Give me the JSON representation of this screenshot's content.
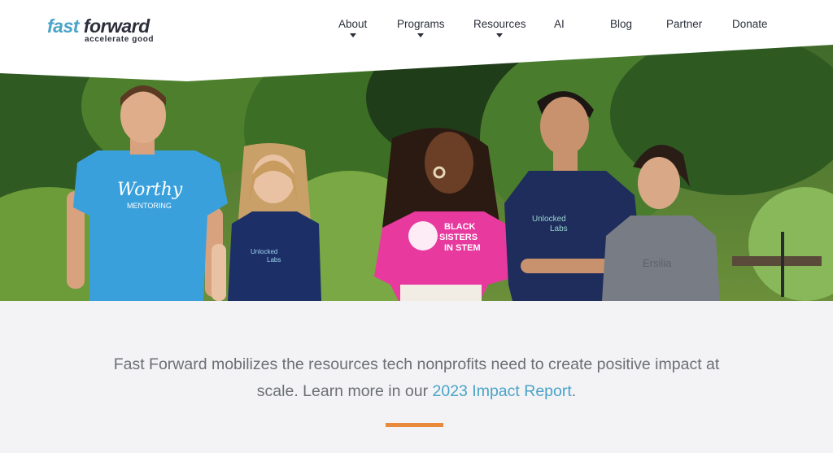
{
  "brand": {
    "name_part1": "fast",
    "name_part2": "forward",
    "tagline": "accelerate good",
    "colors": {
      "blue": "#4aa3c8",
      "dark": "#2b2f3a",
      "orange": "#e88a3a"
    }
  },
  "nav": {
    "items": [
      {
        "label": "About",
        "has_dropdown": true
      },
      {
        "label": "Programs",
        "has_dropdown": true
      },
      {
        "label": "Resources",
        "has_dropdown": true
      },
      {
        "label": "AI",
        "has_dropdown": false
      },
      {
        "label": "Blog",
        "has_dropdown": false
      },
      {
        "label": "Partner",
        "has_dropdown": false
      },
      {
        "label": "Donate",
        "has_dropdown": false
      }
    ]
  },
  "hero": {
    "shirts": [
      "Worthy",
      "MENTORING",
      "Unlocked",
      "Labs",
      "BLACK",
      "SISTERS",
      "IN STEM",
      "Unlocked",
      "Labs",
      "Ersilia"
    ]
  },
  "mission": {
    "text_before": "Fast Forward mobilizes the resources tech nonprofits need to create positive impact at scale. Learn more in our ",
    "link_text": "2023 Impact Report",
    "text_after": "."
  }
}
